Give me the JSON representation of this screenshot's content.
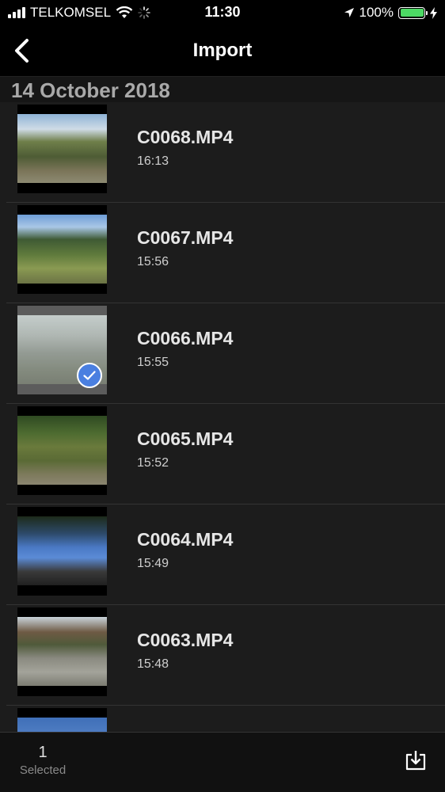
{
  "status_bar": {
    "carrier": "TELKOMSEL",
    "time": "11:30",
    "battery_percent": "100%",
    "battery_color": "#4cd964"
  },
  "nav": {
    "title": "Import",
    "back_icon": "chevron-left-icon"
  },
  "section": {
    "date": "14 October 2018"
  },
  "clips": [
    {
      "name": "C0068.MP4",
      "time": "16:13",
      "selected": false
    },
    {
      "name": "C0067.MP4",
      "time": "15:56",
      "selected": false
    },
    {
      "name": "C0066.MP4",
      "time": "15:55",
      "selected": true
    },
    {
      "name": "C0065.MP4",
      "time": "15:52",
      "selected": false
    },
    {
      "name": "C0064.MP4",
      "time": "15:49",
      "selected": false
    },
    {
      "name": "C0063.MP4",
      "time": "15:48",
      "selected": false
    }
  ],
  "toolbar": {
    "selected_count": "1",
    "selected_label": "Selected",
    "import_icon": "download-tray-icon",
    "check_color": "#4a7fe0"
  }
}
